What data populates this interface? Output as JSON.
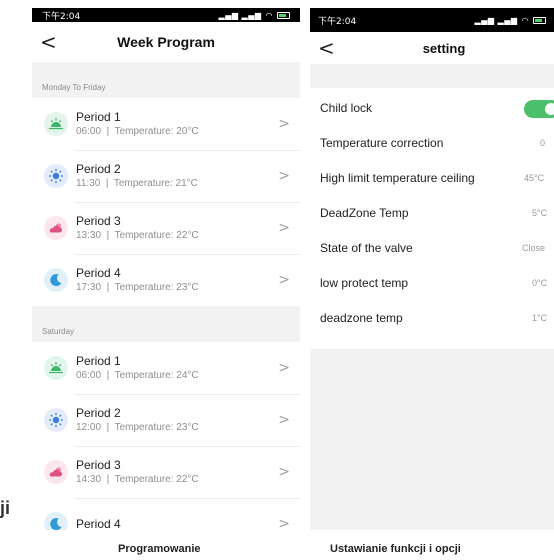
{
  "phone1": {
    "status": {
      "time": "下午2:04",
      "signal": "ﾞnl ﾞnl"
    },
    "title": "Week Program",
    "back": "<",
    "chevron": ">",
    "sections": [
      {
        "label": "Monday To Friday",
        "periods": [
          {
            "name": "Period 1",
            "time": "06:00",
            "temp": "Temperature: 20°C",
            "icon": "sunrise-icon"
          },
          {
            "name": "Period 2",
            "time": "11:30",
            "temp": "Temperature: 21°C",
            "icon": "sun-icon"
          },
          {
            "name": "Period 3",
            "time": "13:30",
            "temp": "Temperature: 22°C",
            "icon": "cloud-sun-icon"
          },
          {
            "name": "Period 4",
            "time": "17:30",
            "temp": "Temperature: 23°C",
            "icon": "moon-icon"
          }
        ]
      },
      {
        "label": "Saturday",
        "periods": [
          {
            "name": "Period 1",
            "time": "06:00",
            "temp": "Temperature: 24°C",
            "icon": "sunrise-icon"
          },
          {
            "name": "Period 2",
            "time": "12:00",
            "temp": "Temperature: 23°C",
            "icon": "sun-icon"
          },
          {
            "name": "Period 3",
            "time": "14:30",
            "temp": "Temperature: 22°C",
            "icon": "cloud-sun-icon"
          },
          {
            "name": "Period 4",
            "time": "",
            "temp": "",
            "icon": "moon-icon"
          }
        ]
      }
    ]
  },
  "phone2": {
    "status": {
      "time": "下午2:04"
    },
    "title": "setting",
    "back": "<",
    "rows": [
      {
        "label": "Child lock",
        "value": "",
        "toggle": true
      },
      {
        "label": "Temperature correction",
        "value": "0"
      },
      {
        "label": "High limit temperature ceiling",
        "value": "45°C"
      },
      {
        "label": "DeadZone Temp",
        "value": "5°C"
      },
      {
        "label": "State of the valve",
        "value": "Close"
      },
      {
        "label": "low protect temp",
        "value": "0°C"
      },
      {
        "label": "deadzone temp",
        "value": "1°C"
      }
    ]
  },
  "captions": {
    "left": "Programowanie",
    "right": "Ustawianie funkcji i opcji",
    "fragment": "ji"
  },
  "colors": {
    "toggle_on": "#4cbf6b",
    "sunrise": "#3bb56a",
    "sun": "#3b7be0",
    "cloud": "#e0507e",
    "moon": "#2e9ad8"
  }
}
